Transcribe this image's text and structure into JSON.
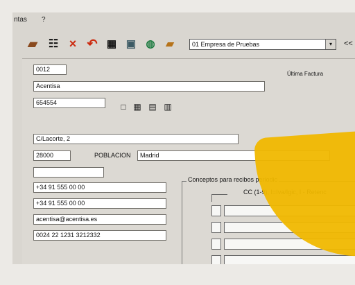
{
  "menu": {
    "items": [
      "ntas",
      "?"
    ]
  },
  "toolbar": {
    "company_select_value": "01 Empresa de Pruebas",
    "dropdown_arrow": "▾",
    "nav_left": "<<",
    "icons": [
      "book-icon",
      "tree-icon",
      "close-icon",
      "red-arrow-icon",
      "grid-icon",
      "monitor-icon",
      "database-icon",
      "open-folder-icon"
    ]
  },
  "form": {
    "code": "0012",
    "name": "Acentisa",
    "nif": "654554",
    "address": "C/Lacorte, 2",
    "postal_code": "28000",
    "city_label": "POBLACION",
    "city_value": "Madrid",
    "phone_1": "+34 91 555 00 00",
    "phone_2": "+34 91 555 00 00",
    "email": "acentisa@acentisa.es",
    "bank_account": "0024 22 1231 3212332",
    "ultima_factura": "Última Factura",
    "conceptos_label": "Conceptos para recibos periodic",
    "cc_label": "CC (1-9), I=Iva/Igic, I - Retenc"
  },
  "colors": {
    "window_bg": "#d9d6d0",
    "field_bg": "#ffffff",
    "accent_yellow": "#f0b800",
    "red": "#cc2b10"
  }
}
